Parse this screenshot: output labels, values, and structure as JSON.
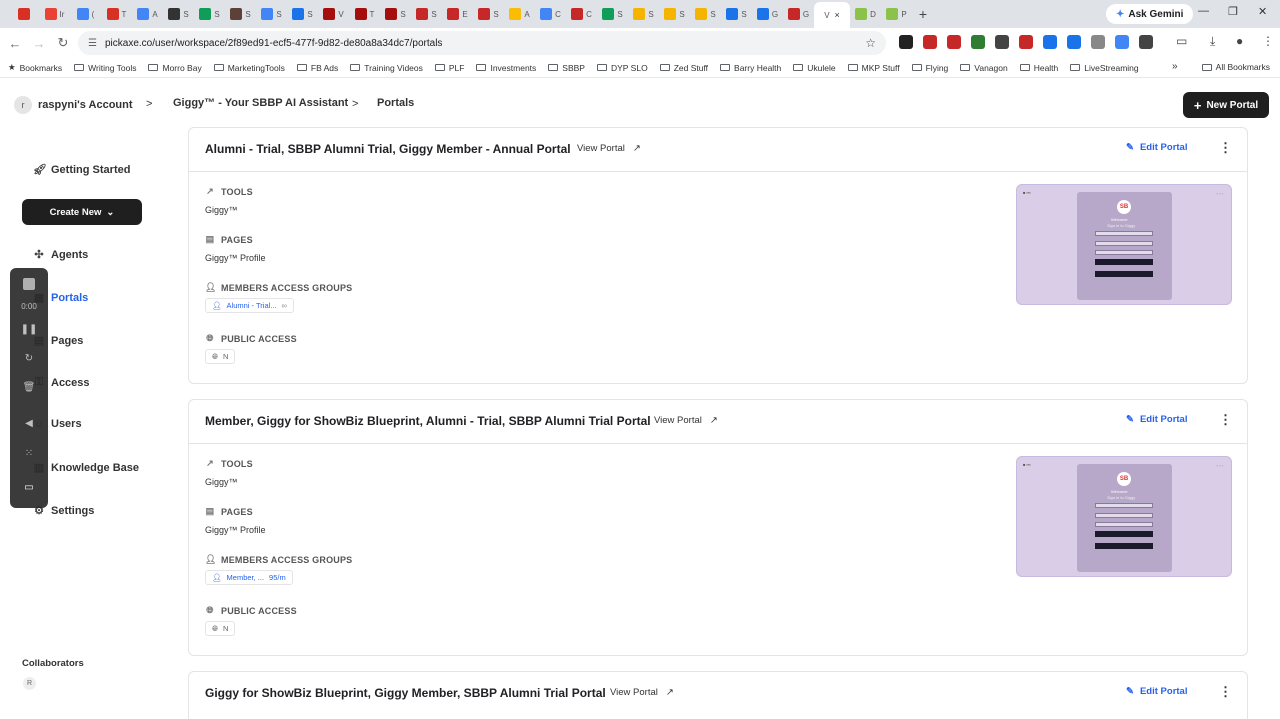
{
  "browser": {
    "tabs": [
      {
        "label": "",
        "color": "#d93025"
      },
      {
        "label": "Ir",
        "color": "#ea4335"
      },
      {
        "label": "(",
        "color": "#4285f4"
      },
      {
        "label": "T",
        "color": "#d93025"
      },
      {
        "label": "A",
        "color": "#4285f4"
      },
      {
        "label": "S",
        "color": "#333333"
      },
      {
        "label": "S",
        "color": "#0f9d58"
      },
      {
        "label": "S",
        "color": "#5d4037"
      },
      {
        "label": "S",
        "color": "#4285f4"
      },
      {
        "label": "S",
        "color": "#1a73e8"
      },
      {
        "label": "V",
        "color": "#a50e0e"
      },
      {
        "label": "T",
        "color": "#a50e0e"
      },
      {
        "label": "S",
        "color": "#a50e0e"
      },
      {
        "label": "S",
        "color": "#c62828"
      },
      {
        "label": "E",
        "color": "#c62828"
      },
      {
        "label": "S",
        "color": "#c62828"
      },
      {
        "label": "A",
        "color": "#fbbc04"
      },
      {
        "label": "C",
        "color": "#4285f4"
      },
      {
        "label": "C",
        "color": "#c62828"
      },
      {
        "label": "S",
        "color": "#0f9d58"
      },
      {
        "label": "S",
        "color": "#f4b400"
      },
      {
        "label": "S",
        "color": "#f4b400"
      },
      {
        "label": "S",
        "color": "#f4b400"
      },
      {
        "label": "S",
        "color": "#1a73e8"
      },
      {
        "label": "G",
        "color": "#1a73e8"
      },
      {
        "label": "G",
        "color": "#c62828"
      }
    ],
    "active_tab": {
      "label": "V",
      "close": "×"
    },
    "after_tabs": [
      {
        "label": "D",
        "color": "#8bc34a"
      },
      {
        "label": "P",
        "color": "#8bc34a"
      }
    ],
    "new_tab": "+",
    "ask_gemini": "Ask Gemini",
    "window_controls": {
      "min": "—",
      "max": "❐",
      "close": "✕"
    },
    "url": "pickaxe.co/user/workspace/2f89ed91-ecf5-477f-9d82-de80a8a34dc7/portals",
    "bookmarks": [
      "Bookmarks",
      "Writing Tools",
      "Morro Bay",
      "MarketingTools",
      "FB Ads",
      "Training Videos",
      "PLF",
      "Investments",
      "SBBP",
      "DYP SLO",
      "Zed Stuff",
      "Barry Health",
      "Ukulele",
      "MKP Stuff",
      "Flying",
      "Vanagon",
      "Health",
      "LiveStreaming"
    ],
    "all_bookmarks": "All Bookmarks",
    "more_bookmarks": "»",
    "extension_colors": [
      "#222222",
      "#c62828",
      "#c62828",
      "#2e7d32",
      "#444444",
      "#c62828",
      "#1a73e8",
      "#1a73e8",
      "#888888",
      "#4285f4",
      "#444444"
    ]
  },
  "header": {
    "avatar_letter": "r",
    "account": "raspyni's Account",
    "crumbs": [
      "Giggy™ - Your SBBP AI Assistant",
      "Portals"
    ],
    "separator": ">",
    "new_portal": "New Portal",
    "new_portal_icon": "+"
  },
  "sidebar": {
    "getting_started": "Getting Started",
    "create_new": "Create New",
    "items": [
      {
        "label": "Agents",
        "icon": "agents-icon",
        "glyph": "✣"
      },
      {
        "label": "Portals",
        "icon": "portals-icon",
        "glyph": "▦"
      },
      {
        "label": "Pages",
        "icon": "pages-icon",
        "glyph": "▤"
      },
      {
        "label": "Access",
        "icon": "access-icon",
        "glyph": "⚿"
      },
      {
        "label": "Users",
        "icon": "users-icon",
        "glyph": "☺"
      },
      {
        "label": "Knowledge Base",
        "icon": "knowledge-icon",
        "glyph": "▥"
      },
      {
        "label": "Settings",
        "icon": "settings-icon",
        "glyph": "⚙"
      }
    ],
    "active_index": 1,
    "collaborators": "Collaborators",
    "collaborator_avatar": "R",
    "accent": "#2563eb"
  },
  "recorder": {
    "time": "0:00"
  },
  "portals": [
    {
      "title": "Alumni - Trial, SBBP Alumni Trial, Giggy Member - Annual Portal",
      "view": "View Portal",
      "edit": "Edit Portal",
      "tools_label": "TOOLS",
      "tools": "Giggy™",
      "pages_label": "PAGES",
      "pages": "Giggy™ Profile",
      "groups_label": "MEMBERS ACCESS GROUPS",
      "group_chip": "Alumni - Trial...",
      "group_extra": "∞",
      "public_label": "PUBLIC ACCESS",
      "public_chip": "N"
    },
    {
      "title": "Member, Giggy for ShowBiz Blueprint, Alumni - Trial, SBBP Alumni Trial Portal",
      "view": "View Portal",
      "edit": "Edit Portal",
      "tools_label": "TOOLS",
      "tools": "Giggy™",
      "pages_label": "PAGES",
      "pages": "Giggy™ Profile",
      "groups_label": "MEMBERS ACCESS GROUPS",
      "group_chip": "Member, ...",
      "group_extra": "95/m",
      "public_label": "PUBLIC ACCESS",
      "public_chip": "N"
    },
    {
      "title": "Giggy for ShowBiz Blueprint, Giggy Member, SBBP Alumni Trial Portal",
      "view": "View Portal",
      "edit": "Edit Portal"
    }
  ],
  "thumbnail": {
    "logo": "SB",
    "welcome": "Welcome",
    "signin": "Sign in to Giggy",
    "signup": "Sign up",
    "google": "Sign up with Google"
  }
}
